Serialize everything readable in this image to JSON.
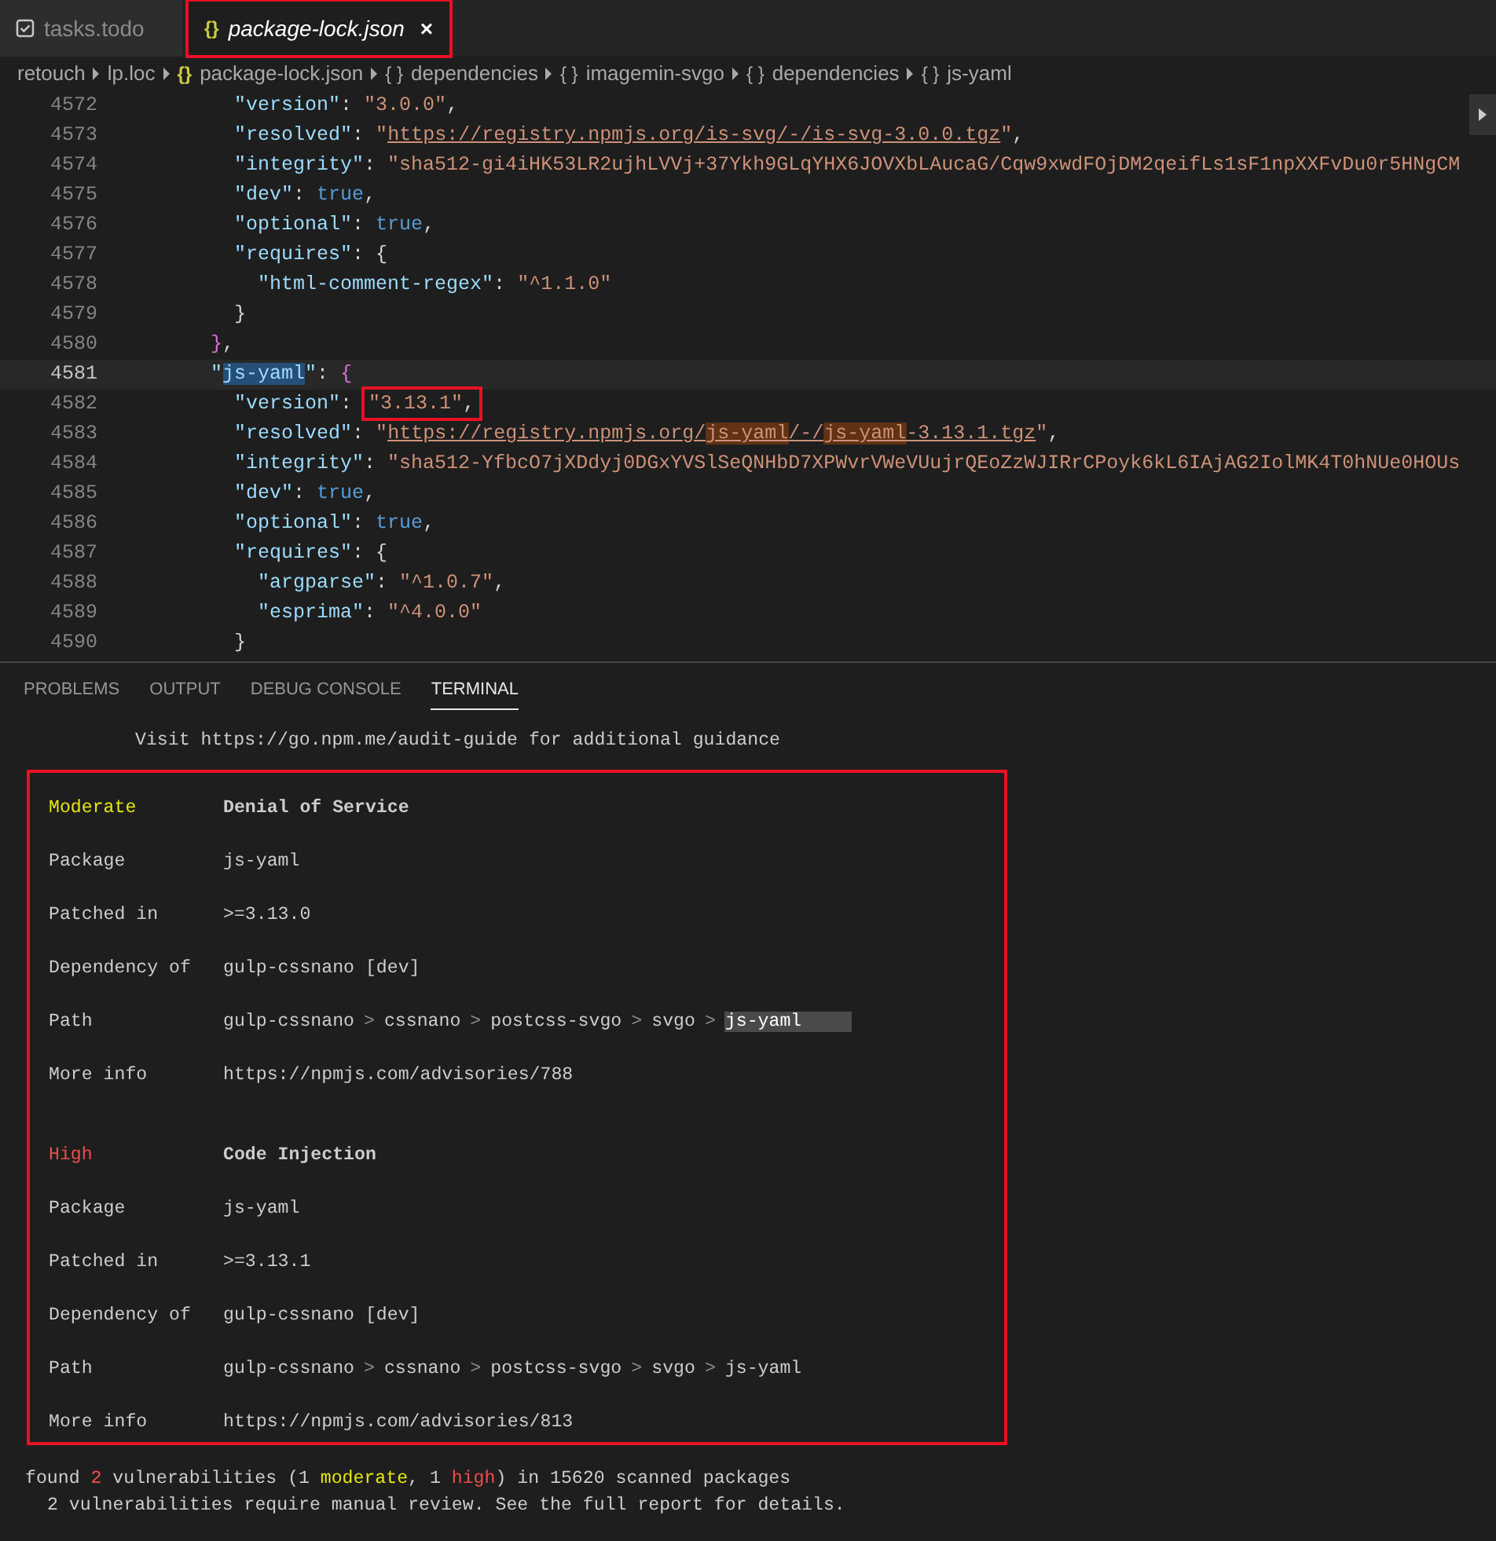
{
  "tabs": [
    {
      "label": "tasks.todo",
      "kind": "todo",
      "selected": false,
      "annotated": false
    },
    {
      "label": "package-lock.json",
      "kind": "json",
      "icon": "{}",
      "close": "×",
      "selected": true,
      "annotated": true
    }
  ],
  "breadcrumbs": [
    {
      "label": "retouch"
    },
    {
      "label": "lp.loc"
    },
    {
      "label": "package-lock.json",
      "kind": "file",
      "icon": "{}"
    },
    {
      "label": "dependencies",
      "kind": "object",
      "icon": "{ }"
    },
    {
      "label": "imagemin-svgo",
      "kind": "object",
      "icon": "{ }"
    },
    {
      "label": "dependencies",
      "kind": "object",
      "icon": "{ }"
    },
    {
      "label": "js-yaml",
      "kind": "object",
      "icon": "{ }"
    }
  ],
  "editor": {
    "lines": [
      {
        "number": "4572",
        "current": false,
        "tokens": [
          {
            "kind": "key",
            "text": "          \"version\""
          },
          {
            "kind": "punct",
            "text": ": "
          },
          {
            "kind": "str",
            "text": "\"3.0.0\""
          },
          {
            "kind": "punct",
            "text": ","
          }
        ]
      },
      {
        "number": "4573",
        "current": false,
        "tokens": [
          {
            "kind": "key",
            "text": "          \"resolved\""
          },
          {
            "kind": "punct",
            "text": ": "
          },
          {
            "kind": "str",
            "text": "\""
          },
          {
            "kind": "link",
            "text": "https://registry.npmjs.org/is-svg/-/is-svg-3.0.0.tgz"
          },
          {
            "kind": "str",
            "text": "\""
          },
          {
            "kind": "punct",
            "text": ","
          }
        ]
      },
      {
        "number": "4574",
        "current": false,
        "tokens": [
          {
            "kind": "key",
            "text": "          \"integrity\""
          },
          {
            "kind": "punct",
            "text": ": "
          },
          {
            "kind": "str",
            "text": "\"sha512-gi4iHK53LR2ujhLVVj+37Ykh9GLqYHX6JOVXbLAucaG/Cqw9xwdFOjDM2qeifLs1sF1npXXFvDu0r5HNgCM"
          }
        ]
      },
      {
        "number": "4575",
        "current": false,
        "tokens": [
          {
            "kind": "key",
            "text": "          \"dev\""
          },
          {
            "kind": "punct",
            "text": ": "
          },
          {
            "kind": "bool",
            "text": "true"
          },
          {
            "kind": "punct",
            "text": ","
          }
        ]
      },
      {
        "number": "4576",
        "current": false,
        "tokens": [
          {
            "kind": "key",
            "text": "          \"optional\""
          },
          {
            "kind": "punct",
            "text": ": "
          },
          {
            "kind": "bool",
            "text": "true"
          },
          {
            "kind": "punct",
            "text": ","
          }
        ]
      },
      {
        "number": "4577",
        "current": false,
        "tokens": [
          {
            "kind": "key",
            "text": "          \"requires\""
          },
          {
            "kind": "punct",
            "text": ": {"
          }
        ]
      },
      {
        "number": "4578",
        "current": false,
        "tokens": [
          {
            "kind": "key",
            "text": "            \"html-comment-regex\""
          },
          {
            "kind": "punct",
            "text": ": "
          },
          {
            "kind": "str",
            "text": "\"^1.1.0\""
          }
        ]
      },
      {
        "number": "4579",
        "current": false,
        "tokens": [
          {
            "kind": "punct",
            "text": "          }"
          }
        ]
      },
      {
        "number": "4580",
        "current": false,
        "tokens": [
          {
            "kind": "bracket",
            "text": "        }"
          },
          {
            "kind": "punct",
            "text": ","
          }
        ]
      },
      {
        "number": "4581",
        "current": true,
        "tokens": [
          {
            "kind": "key",
            "text": "        \""
          },
          {
            "kind": "keysel",
            "text": "js-yaml"
          },
          {
            "kind": "key",
            "text": "\""
          },
          {
            "kind": "punct",
            "text": ": "
          },
          {
            "kind": "bracket",
            "text": "{"
          }
        ]
      },
      {
        "number": "4582",
        "current": false,
        "tokens": [
          {
            "kind": "key",
            "text": "          \"version\""
          },
          {
            "kind": "punct",
            "text": ": "
          },
          {
            "kind": "str",
            "text": "\"3.13.1\"",
            "annotated": true
          },
          {
            "kind": "punct",
            "text": ",",
            "annotated": true
          }
        ]
      },
      {
        "number": "4583",
        "current": false,
        "tokens": [
          {
            "kind": "key",
            "text": "          \"resolved\""
          },
          {
            "kind": "punct",
            "text": ": "
          },
          {
            "kind": "str",
            "text": "\""
          },
          {
            "kind": "link",
            "text": "https://registry.npmjs.org/"
          },
          {
            "kind": "linkmatch",
            "text": "js-yaml"
          },
          {
            "kind": "link",
            "text": "/-/"
          },
          {
            "kind": "linkmatch",
            "text": "js-yaml"
          },
          {
            "kind": "link",
            "text": "-3.13.1.tgz"
          },
          {
            "kind": "str",
            "text": "\""
          },
          {
            "kind": "punct",
            "text": ","
          }
        ]
      },
      {
        "number": "4584",
        "current": false,
        "tokens": [
          {
            "kind": "key",
            "text": "          \"integrity\""
          },
          {
            "kind": "punct",
            "text": ": "
          },
          {
            "kind": "str",
            "text": "\"sha512-YfbcO7jXDdyj0DGxYVSlSeQNHbD7XPWvrVWeVUujrQEoZzWJIRrCPoyk6kL6IAjAG2IolMK4T0hNUe0HOUs"
          }
        ]
      },
      {
        "number": "4585",
        "current": false,
        "tokens": [
          {
            "kind": "key",
            "text": "          \"dev\""
          },
          {
            "kind": "punct",
            "text": ": "
          },
          {
            "kind": "bool",
            "text": "true"
          },
          {
            "kind": "punct",
            "text": ","
          }
        ]
      },
      {
        "number": "4586",
        "current": false,
        "tokens": [
          {
            "kind": "key",
            "text": "          \"optional\""
          },
          {
            "kind": "punct",
            "text": ": "
          },
          {
            "kind": "bool",
            "text": "true"
          },
          {
            "kind": "punct",
            "text": ","
          }
        ]
      },
      {
        "number": "4587",
        "current": false,
        "tokens": [
          {
            "kind": "key",
            "text": "          \"requires\""
          },
          {
            "kind": "punct",
            "text": ": {"
          }
        ]
      },
      {
        "number": "4588",
        "current": false,
        "tokens": [
          {
            "kind": "key",
            "text": "            \"argparse\""
          },
          {
            "kind": "punct",
            "text": ": "
          },
          {
            "kind": "str",
            "text": "\"^1.0.7\""
          },
          {
            "kind": "punct",
            "text": ","
          }
        ]
      },
      {
        "number": "4589",
        "current": false,
        "tokens": [
          {
            "kind": "key",
            "text": "            \"esprima\""
          },
          {
            "kind": "punct",
            "text": ": "
          },
          {
            "kind": "str",
            "text": "\"^4.0.0\""
          }
        ]
      },
      {
        "number": "4590",
        "current": false,
        "tokens": [
          {
            "kind": "punct",
            "text": "          }"
          }
        ]
      }
    ]
  },
  "panel_tabs": [
    {
      "label": "PROBLEMS",
      "selected": false
    },
    {
      "label": "OUTPUT",
      "selected": false
    },
    {
      "label": "DEBUG CONSOLE",
      "selected": false
    },
    {
      "label": "TERMINAL",
      "selected": true
    }
  ],
  "terminal": {
    "intro": "Visit https://go.npm.me/audit-guide for additional guidance",
    "advisories_annotated": true,
    "advisories": [
      {
        "severity": "Moderate",
        "kind": "moderate",
        "title": "Denial of Service",
        "rows": [
          {
            "label": "Package",
            "value": "js-yaml"
          },
          {
            "label": "Patched in",
            "value": ">=3.13.0"
          },
          {
            "label": "Dependency of",
            "value": "gulp-cssnano [dev]"
          }
        ],
        "path_label": "Path",
        "path_separator": ">",
        "path": [
          {
            "text": "gulp-cssnano",
            "selected": false
          },
          {
            "text": "cssnano",
            "selected": false
          },
          {
            "text": "postcss-svgo",
            "selected": false
          },
          {
            "text": "svgo",
            "selected": false
          },
          {
            "text": "js-yaml",
            "selected": true
          }
        ],
        "info_label": "More info",
        "info": "https://npmjs.com/advisories/788"
      },
      {
        "severity": "High",
        "kind": "high",
        "title": "Code Injection",
        "rows": [
          {
            "label": "Package",
            "value": "js-yaml"
          },
          {
            "label": "Patched in",
            "value": ">=3.13.1"
          },
          {
            "label": "Dependency of",
            "value": "gulp-cssnano [dev]"
          }
        ],
        "path_label": "Path",
        "path_separator": ">",
        "path": [
          {
            "text": "gulp-cssnano",
            "selected": false
          },
          {
            "text": "cssnano",
            "selected": false
          },
          {
            "text": "postcss-svgo",
            "selected": false
          },
          {
            "text": "svgo",
            "selected": false
          },
          {
            "text": "js-yaml",
            "selected": false
          }
        ],
        "info_label": "More info",
        "info": "https://npmjs.com/advisories/813"
      }
    ],
    "summary": [
      {
        "kind": "plain",
        "text": "found "
      },
      {
        "kind": "high",
        "text": "2"
      },
      {
        "kind": "plain",
        "text": " vulnerabilities (1 "
      },
      {
        "kind": "moderate",
        "text": "moderate"
      },
      {
        "kind": "plain",
        "text": ", 1 "
      },
      {
        "kind": "high",
        "text": "high"
      },
      {
        "kind": "plain",
        "text": ") in 15620 scanned packages"
      }
    ],
    "summary_detail": "2 vulnerabilities require manual review. See the full report for details."
  }
}
